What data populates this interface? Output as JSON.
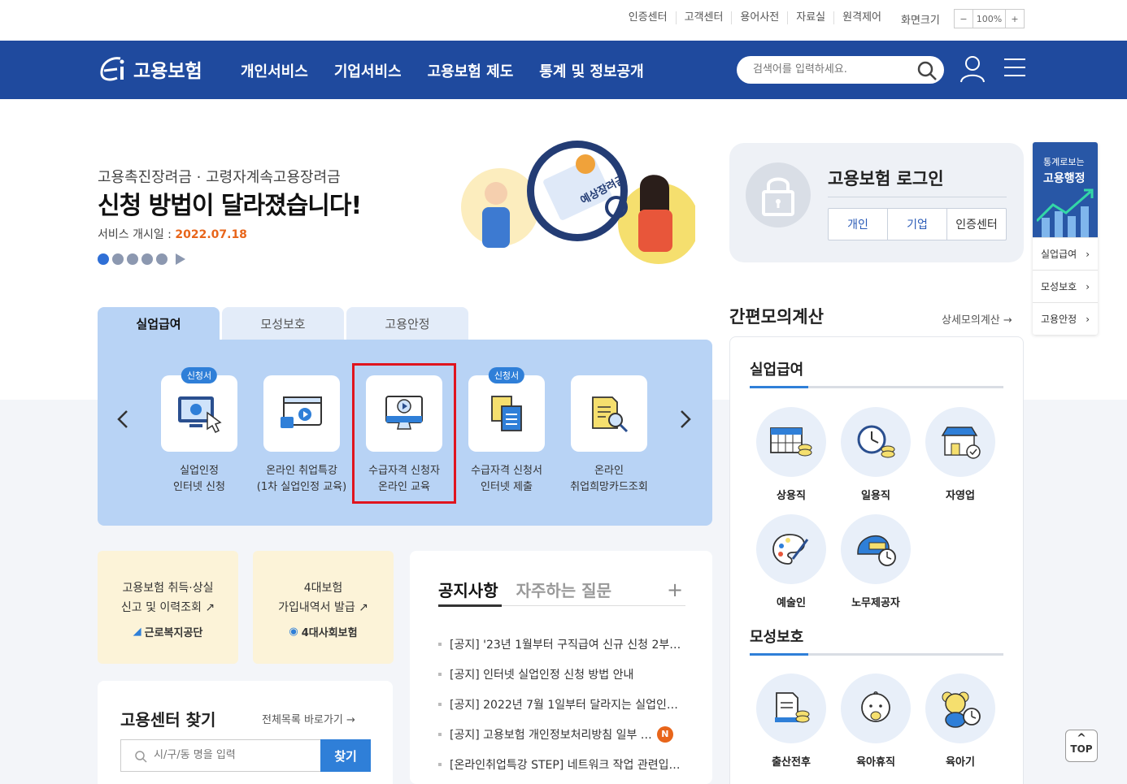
{
  "util": {
    "links": [
      "인증센터",
      "고객센터",
      "용어사전",
      "자료실",
      "원격제어"
    ],
    "zoom_label": "화면크기",
    "zoom_minus": "−",
    "zoom_value": "100%",
    "zoom_plus": "+"
  },
  "nav": {
    "logo_text": "고용보험",
    "menu": [
      "개인서비스",
      "기업서비스",
      "고용보험 제도",
      "통계 및 정보공개"
    ],
    "search_placeholder": "검색어를 입력하세요."
  },
  "hero": {
    "subtitle": "고용촉진장려금 · 고령자계속고용장려금",
    "title": "신청 방법이 달라졌습니다!",
    "date_label": "서비스 개시일 : ",
    "date_value": "2022.07.18",
    "illustration_text": "예상장려금"
  },
  "login": {
    "title": "고용보험 로그인",
    "buttons": [
      "개인",
      "기업",
      "인증센터"
    ]
  },
  "side_widget": {
    "line1": "통계로보는",
    "line2": "고용행정",
    "items": [
      "실업급여",
      "모성보호",
      "고용안정"
    ]
  },
  "tabs": [
    "실업급여",
    "모성보호",
    "고용안정"
  ],
  "services": [
    {
      "badge": "신청서",
      "line1": "실업인정",
      "line2": "인터넷 신청"
    },
    {
      "badge": "",
      "line1": "온라인 취업특강",
      "line2": "(1차 실업인정 교육)"
    },
    {
      "badge": "",
      "line1": "수급자격 신청자",
      "line2": "온라인 교육"
    },
    {
      "badge": "신청서",
      "line1": "수급자격 신청서",
      "line2": "인터넷 제출"
    },
    {
      "badge": "",
      "line1": "온라인",
      "line2": "취업희망카드조회"
    }
  ],
  "cards": [
    {
      "line1": "고용보험 취득·상실",
      "line2": "신고 및 이력조회",
      "source": "근로복지공단"
    },
    {
      "line1": "4대보험",
      "line2": "가입내역서 발급",
      "source": "4대사회보험"
    }
  ],
  "notice": {
    "tab_on": "공지사항",
    "tab_off": "자주하는 질문",
    "plus": "+",
    "items": [
      "[공지] '23년 1월부터 구직급여 신규 신청 2부…",
      "[공지] 인터넷 실업인정 신청 방법 안내",
      "[공지] 2022년 7월 1일부터 달라지는 실업인…",
      "[공지] 고용보험 개인정보처리방침 일부 …",
      "[온라인취업특강 STEP] 네트워크 작업 관련입…"
    ],
    "new_badge": "N"
  },
  "finder": {
    "title": "고용센터 찾기",
    "link": "전체목록 바로가기",
    "placeholder": "시/구/동 명을 입력",
    "button": "찾기"
  },
  "calc": {
    "title": "간편모의계산",
    "link": "상세모의계산",
    "section1": "실업급여",
    "section1_items": [
      "상용직",
      "일용직",
      "자영업",
      "예술인",
      "노무제공자"
    ],
    "section2": "모성보호",
    "section2_items": [
      "출산전후",
      "육아휴직",
      "육아기"
    ]
  },
  "top_button": "TOP",
  "colors": {
    "nav_blue": "#1f4a9e",
    "panel_blue": "#b8d3f5",
    "accent_orange": "#e8651a",
    "highlight_red": "#e0141e"
  }
}
